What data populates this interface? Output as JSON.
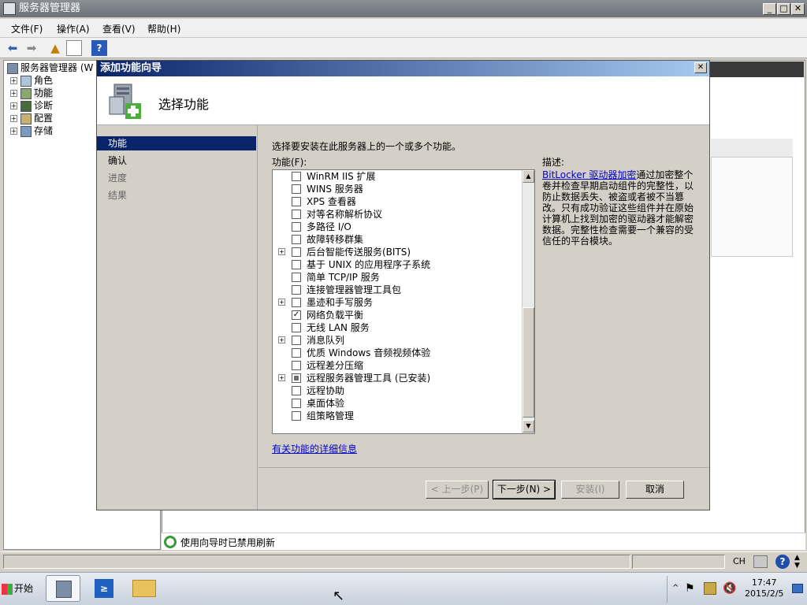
{
  "app": {
    "title": "服务器管理器"
  },
  "menu": [
    "文件(F)",
    "操作(A)",
    "查看(V)",
    "帮助(H)"
  ],
  "tree": {
    "root": "服务器管理器 (W",
    "items": [
      "角色",
      "功能",
      "诊断",
      "配置",
      "存储"
    ]
  },
  "wizard": {
    "title": "添加功能向导",
    "header": "选择功能",
    "steps": [
      "功能",
      "确认",
      "进度",
      "结果"
    ],
    "instruction": "选择要安装在此服务器上的一个或多个功能。",
    "features_label": "功能(F):",
    "features": [
      {
        "label": "WinRM IIS 扩展",
        "checked": false,
        "expandable": false
      },
      {
        "label": "WINS 服务器",
        "checked": false,
        "expandable": false
      },
      {
        "label": "XPS 查看器",
        "checked": false,
        "expandable": false
      },
      {
        "label": "对等名称解析协议",
        "checked": false,
        "expandable": false
      },
      {
        "label": "多路径 I/O",
        "checked": false,
        "expandable": false
      },
      {
        "label": "故障转移群集",
        "checked": false,
        "expandable": false
      },
      {
        "label": "后台智能传送服务(BITS)",
        "checked": false,
        "expandable": true
      },
      {
        "label": "基于 UNIX 的应用程序子系统",
        "checked": false,
        "expandable": false
      },
      {
        "label": "简单 TCP/IP 服务",
        "checked": false,
        "expandable": false
      },
      {
        "label": "连接管理器管理工具包",
        "checked": false,
        "expandable": false
      },
      {
        "label": "墨迹和手写服务",
        "checked": false,
        "expandable": true
      },
      {
        "label": "网络负载平衡",
        "checked": true,
        "expandable": false
      },
      {
        "label": "无线 LAN 服务",
        "checked": false,
        "expandable": false
      },
      {
        "label": "消息队列",
        "checked": false,
        "expandable": true
      },
      {
        "label": "优质 Windows 音频视频体验",
        "checked": false,
        "expandable": false
      },
      {
        "label": "远程差分压缩",
        "checked": false,
        "expandable": false
      },
      {
        "label": "远程服务器管理工具  (已安装)",
        "checked": "partial",
        "expandable": true
      },
      {
        "label": "远程协助",
        "checked": false,
        "expandable": false
      },
      {
        "label": "桌面体验",
        "checked": false,
        "expandable": false
      },
      {
        "label": "组策略管理",
        "checked": false,
        "expandable": false
      }
    ],
    "more_link": "有关功能的详细信息",
    "desc_label": "描述:",
    "desc_link": "BitLocker 驱动器加密",
    "desc_text": "通过加密整个卷并检查早期启动组件的完整性，以防止数据丢失、被盗或者被不当篡改。只有成功验证这些组件并在原始计算机上找到加密的驱动器才能解密数据。完整性检查需要一个兼容的受信任的平台模块。",
    "buttons": {
      "back": "< 上一步(P)",
      "next": "下一步(N) >",
      "install": "安装(I)",
      "cancel": "取消"
    }
  },
  "status": {
    "text": "使用向导时已禁用刷新"
  },
  "statusbar": {
    "lang": "CH"
  },
  "taskbar": {
    "start": "开始",
    "time": "17:47",
    "date": "2015/2/5"
  }
}
